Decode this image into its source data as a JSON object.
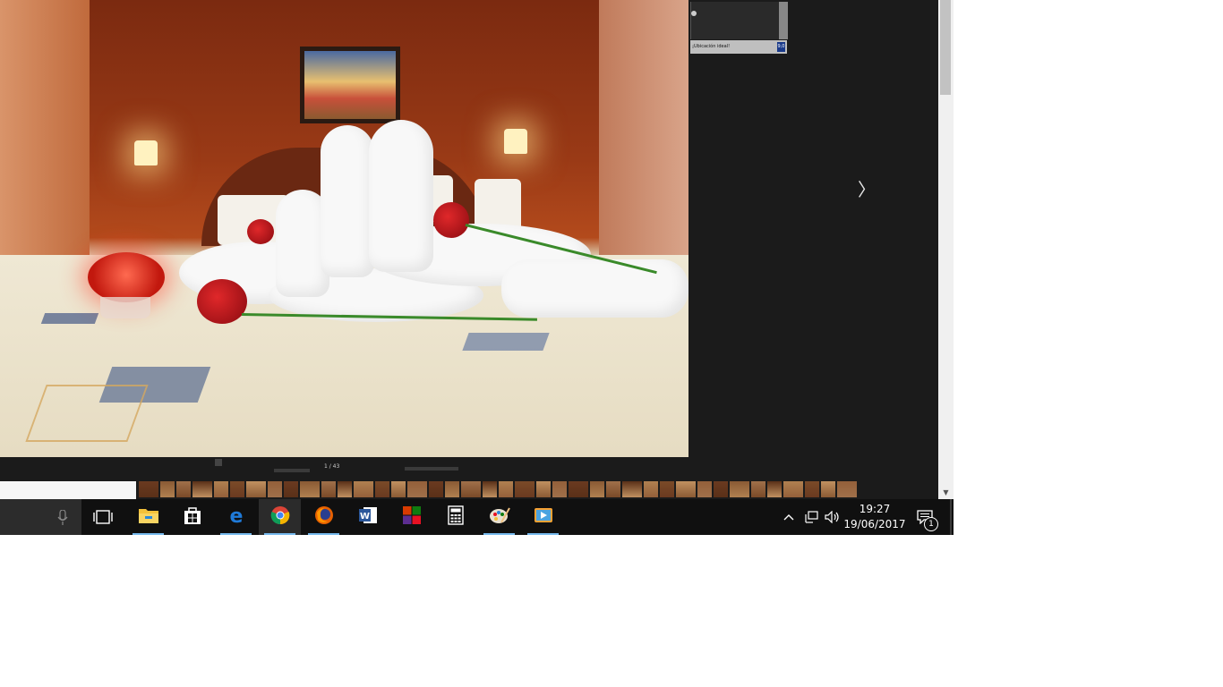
{
  "viewer": {
    "counter": "1 / 43",
    "next_label": "〉",
    "side_label": "¡Ubicación ideal!",
    "side_badge": "9,0"
  },
  "filmstrip": {
    "count": 40
  },
  "taskbar": {
    "apps": [
      {
        "name": "file-explorer",
        "active": false
      },
      {
        "name": "store",
        "active": false
      },
      {
        "name": "edge",
        "active": false
      },
      {
        "name": "chrome",
        "active": true
      },
      {
        "name": "firefox",
        "active": false
      },
      {
        "name": "word",
        "active": false
      },
      {
        "name": "office",
        "active": false
      },
      {
        "name": "calculator",
        "active": false
      },
      {
        "name": "paint",
        "active": false
      },
      {
        "name": "media-player",
        "active": false
      }
    ],
    "clock_time": "19:27",
    "clock_date": "19/06/2017",
    "notification_count": "1"
  },
  "colors": {
    "taskbar_bg": "#101010",
    "accent": "#76b9ed"
  }
}
